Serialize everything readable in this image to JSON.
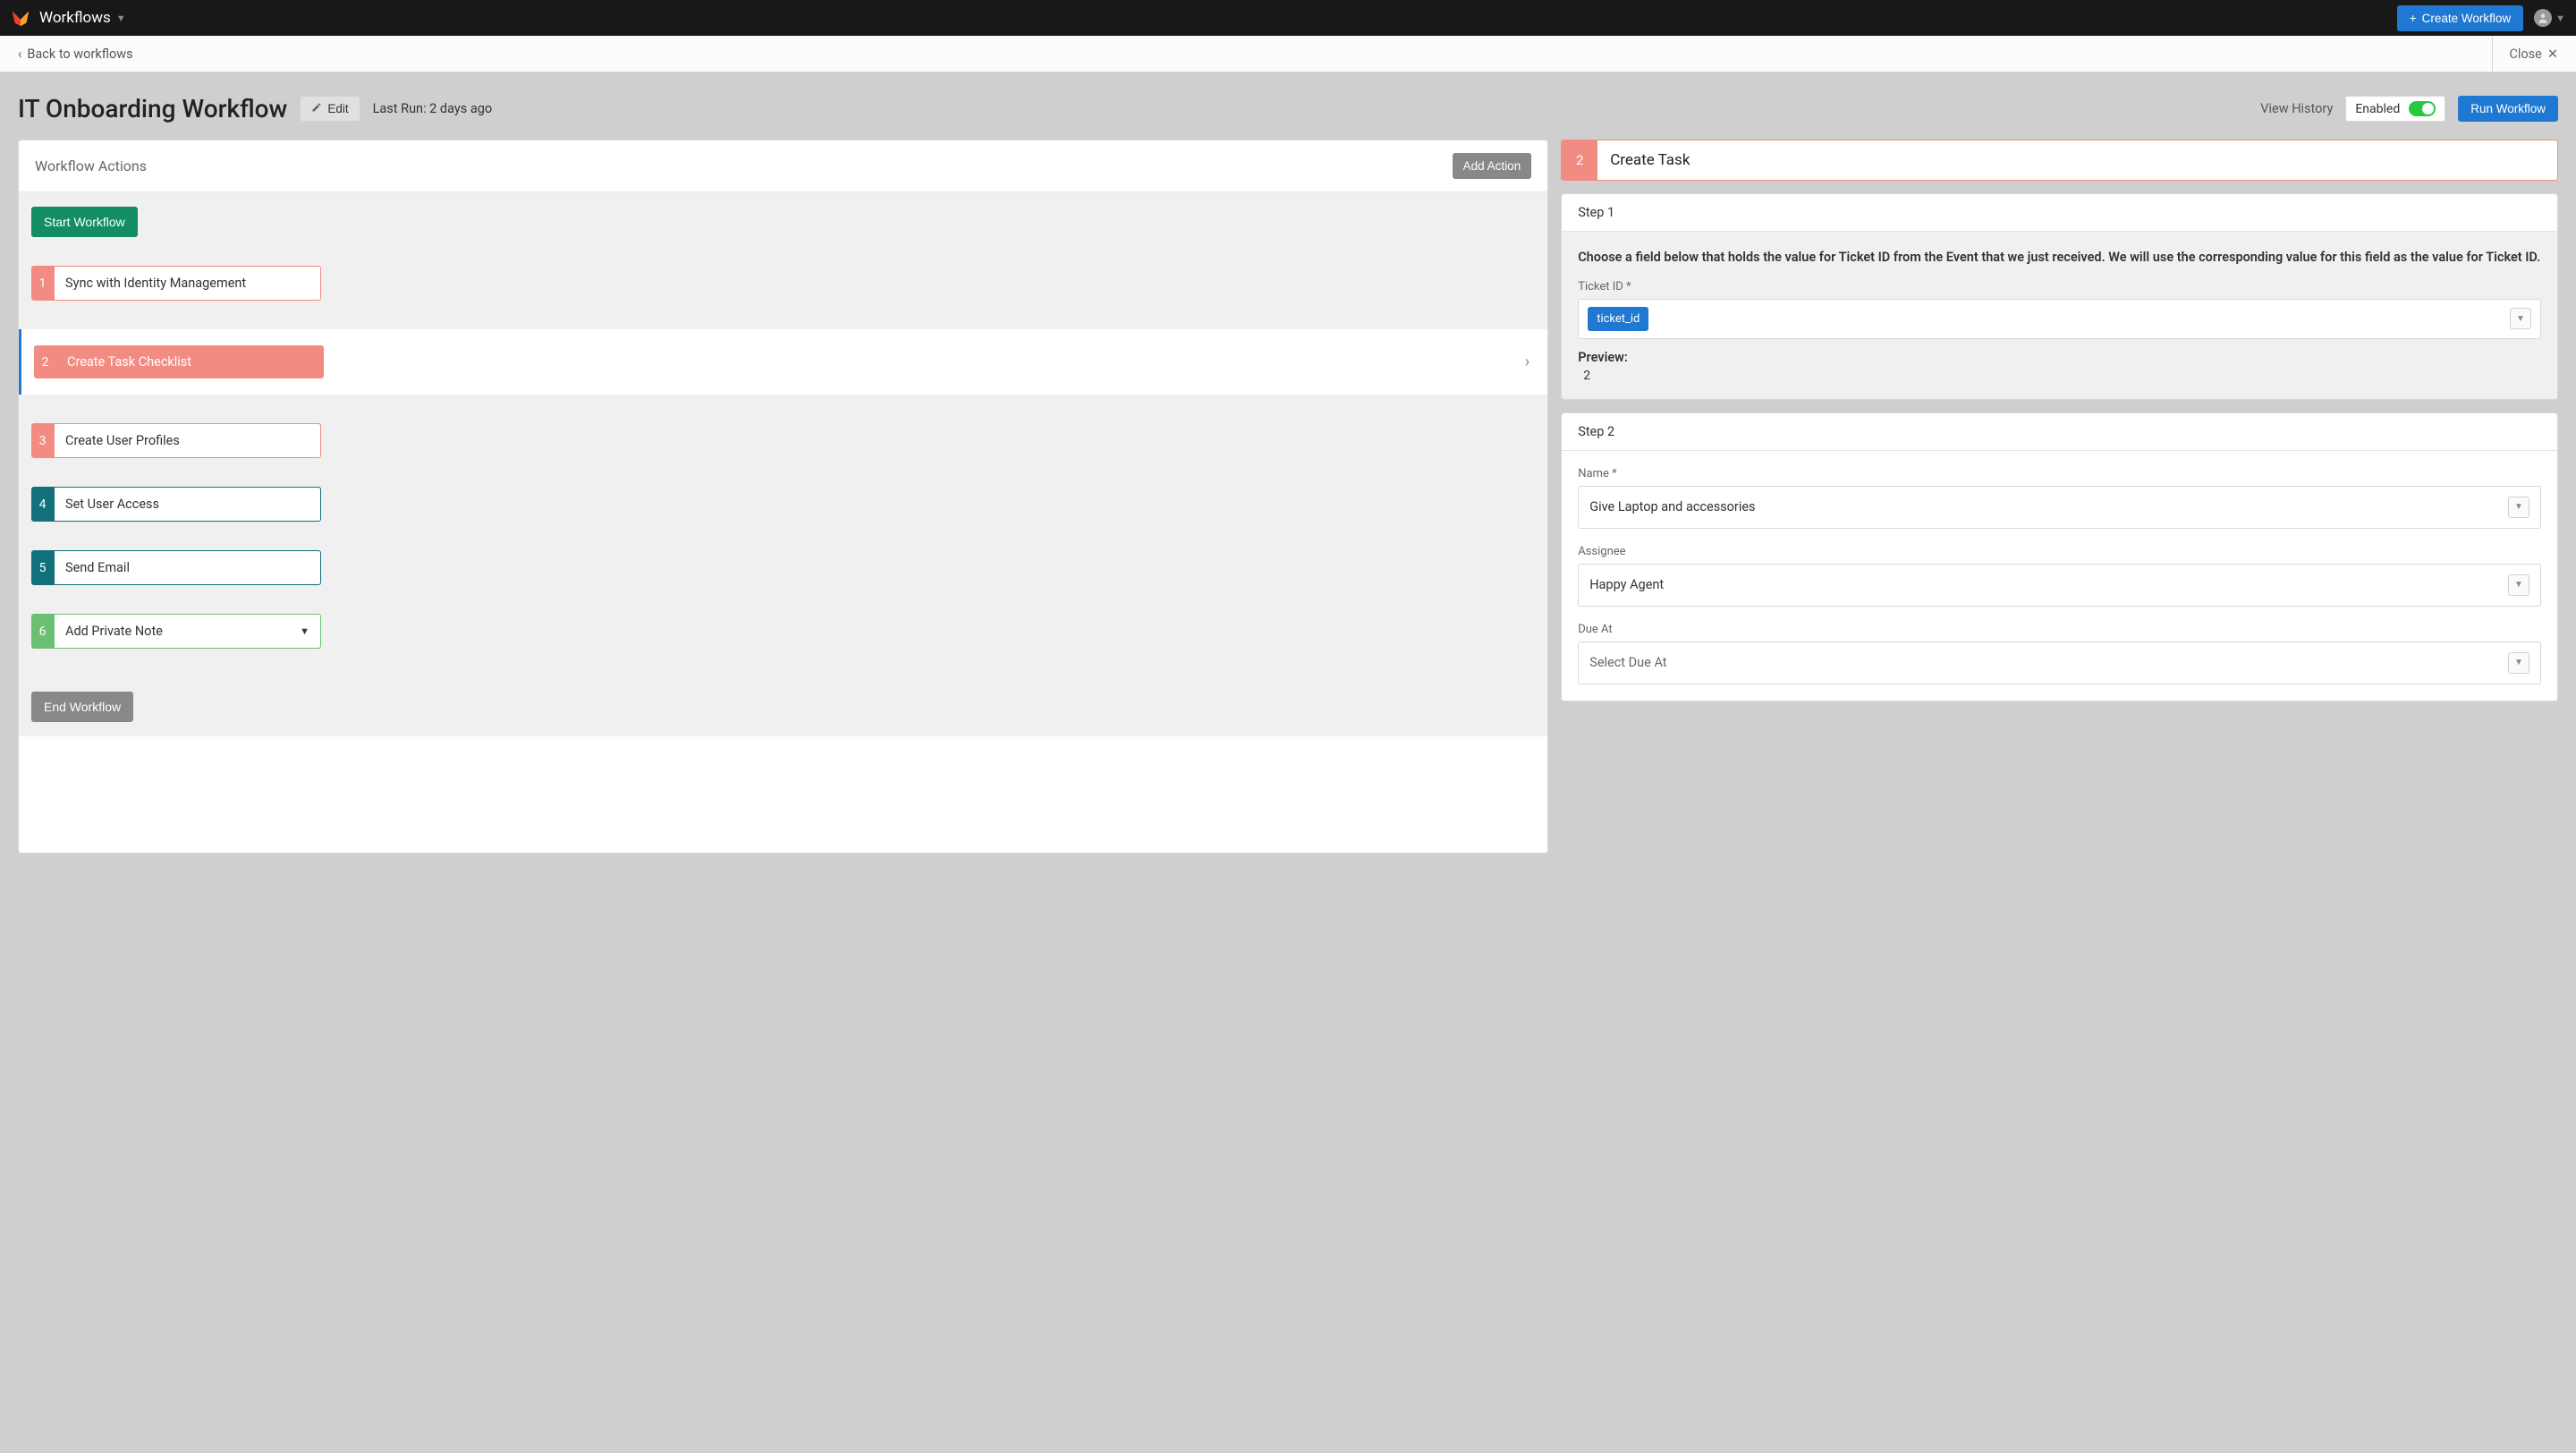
{
  "topbar": {
    "section": "Workflows",
    "create_btn": "Create Workflow"
  },
  "subbar": {
    "back": "Back to workflows",
    "close": "Close"
  },
  "header": {
    "title": "IT Onboarding Workflow",
    "edit": "Edit",
    "last_run": "Last Run: 2 days ago",
    "view_history": "View History",
    "enabled_label": "Enabled",
    "run_btn": "Run Workflow"
  },
  "actions": {
    "panel_title": "Workflow Actions",
    "add_btn": "Add Action",
    "start_btn": "Start Workflow",
    "end_btn": "End Workflow",
    "items": [
      {
        "n": "1",
        "label": "Sync with Identity Management",
        "color": "pink"
      },
      {
        "n": "2",
        "label": "Create Task Checklist",
        "color": "pink",
        "selected": true
      },
      {
        "n": "3",
        "label": "Create User Profiles",
        "color": "pink"
      },
      {
        "n": "4",
        "label": "Set User Access",
        "color": "teal"
      },
      {
        "n": "5",
        "label": "Send Email",
        "color": "teal"
      },
      {
        "n": "6",
        "label": "Add Private Note",
        "color": "green",
        "dropdown": true
      }
    ]
  },
  "detail": {
    "num": "2",
    "title": "Create Task",
    "step1": {
      "header": "Step 1",
      "instruction": "Choose a field below that holds the value for Ticket ID from the Event that we just received. We will use the corresponding value for this field as the value for Ticket ID.",
      "field_label": "Ticket ID *",
      "chip": "ticket_id",
      "preview_label": "Preview:",
      "preview_value": "2"
    },
    "step2": {
      "header": "Step 2",
      "name_label": "Name *",
      "name_value": "Give Laptop and accessories",
      "assignee_label": "Assignee",
      "assignee_value": "Happy Agent",
      "due_label": "Due At",
      "due_placeholder": "Select Due At"
    }
  }
}
